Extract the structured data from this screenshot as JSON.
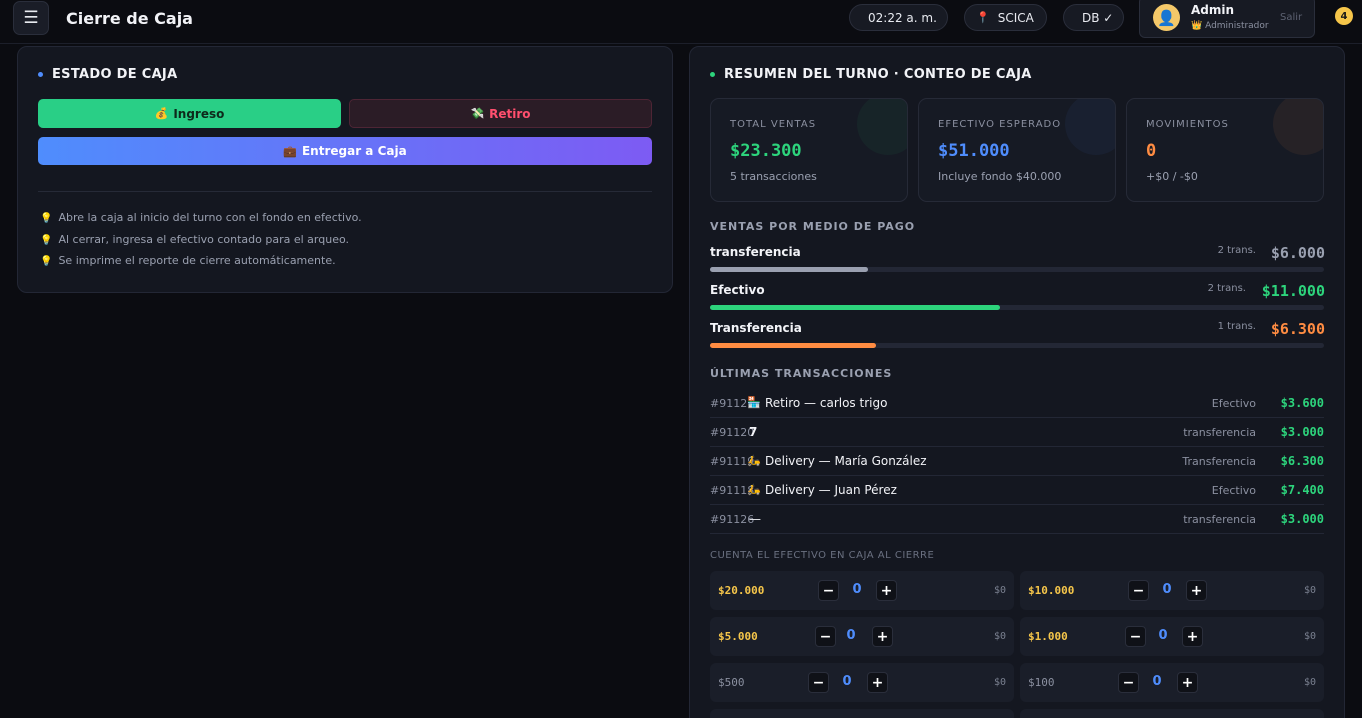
{
  "header": {
    "menu_icon": "☰",
    "title": "Cierre de Caja",
    "clock": "02:22 a. m.",
    "location": "SCICA",
    "db_status": "DB ✓",
    "user_name": "Admin",
    "user_role": "👑 Administrador",
    "logout": "Salir",
    "notifications": "4"
  },
  "estado": {
    "title": "ESTADO DE CAJA",
    "ingreso_icon": "💰",
    "ingreso_label": "Ingreso",
    "retiro_icon": "💸",
    "retiro_label": "Retiro",
    "entregar_icon": "💼",
    "entregar_label": "Entregar a Caja",
    "tips": [
      "Abre la caja al inicio del turno con el fondo en efectivo.",
      "Al cerrar, ingresa el efectivo contado para el arqueo.",
      "Se imprime el reporte de cierre automáticamente."
    ]
  },
  "resumen": {
    "title": "RESUMEN DEL TURNO · CONTEO DE CAJA",
    "stats": [
      {
        "label": "TOTAL VENTAS",
        "value": "$23.300",
        "sub": "5 transacciones",
        "color": "#2dd47c"
      },
      {
        "label": "EFECTIVO ESPERADO",
        "value": "$51.000",
        "sub": "Incluye fondo $40.000",
        "color": "#4f8dfd"
      },
      {
        "label": "MOVIMIENTOS",
        "value": "0",
        "sub": "+$0 / -$0",
        "color": "#ff8c42"
      }
    ],
    "payments_title": "VENTAS POR MEDIO DE PAGO",
    "payments": [
      {
        "name": "transferencia",
        "count": "2 trans.",
        "amount": "$6.000",
        "color": "#9aa0b0",
        "share": 0.258
      },
      {
        "name": "Efectivo",
        "count": "2 trans.",
        "amount": "$11.000",
        "color": "#2dd47c",
        "share": 0.472
      },
      {
        "name": "Transferencia",
        "count": "1 trans.",
        "amount": "$6.300",
        "color": "#ff8c42",
        "share": 0.27
      }
    ],
    "transactions_title": "ÚLTIMAS TRANSACCIONES",
    "transactions": [
      {
        "id": "#91121",
        "icon": "🏪",
        "desc": "Retiro — carlos trigo",
        "method": "Efectivo",
        "amount": "$3.600"
      },
      {
        "id": "#91120",
        "icon": "",
        "desc": "7",
        "method": "transferencia",
        "amount": "$3.000"
      },
      {
        "id": "#91119",
        "icon": "🛵",
        "desc": "Delivery — María González",
        "method": "Transferencia",
        "amount": "$6.300"
      },
      {
        "id": "#91118",
        "icon": "🛵",
        "desc": "Delivery — Juan Pérez",
        "method": "Efectivo",
        "amount": "$7.400"
      },
      {
        "id": "#91126",
        "icon": "",
        "desc": "—",
        "method": "transferencia",
        "amount": "$3.000"
      }
    ],
    "count_title": "CUENTA EL EFECTIVO EN CAJA AL CIERRE",
    "denominations": [
      {
        "label": "$20.000",
        "qty": "0",
        "subtotal": "$0",
        "bill": true
      },
      {
        "label": "$10.000",
        "qty": "0",
        "subtotal": "$0",
        "bill": true
      },
      {
        "label": "$5.000",
        "qty": "0",
        "subtotal": "$0",
        "bill": true
      },
      {
        "label": "$1.000",
        "qty": "0",
        "subtotal": "$0",
        "bill": true
      },
      {
        "label": "$500",
        "qty": "0",
        "subtotal": "$0",
        "bill": false
      },
      {
        "label": "$100",
        "qty": "0",
        "subtotal": "$0",
        "bill": false
      }
    ],
    "minus": "−",
    "plus": "+"
  }
}
